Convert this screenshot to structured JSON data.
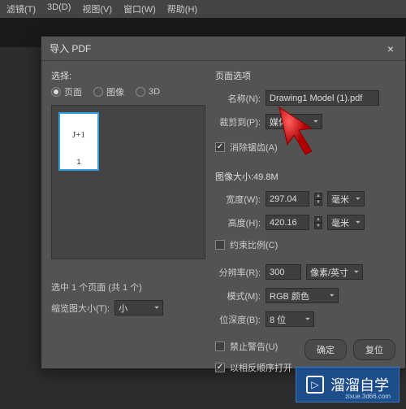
{
  "menubar": {
    "filter": "滤镜(T)",
    "threed": "3D(D)",
    "view": "视图(V)",
    "window": "窗口(W)",
    "help": "帮助(H)"
  },
  "dialog": {
    "title": "导入 PDF",
    "close": "×"
  },
  "left": {
    "select_label": "选择:",
    "radio_page": "页面",
    "radio_image": "图像",
    "radio_3d": "3D",
    "thumb_content": "J+1",
    "thumb_num": "1",
    "selection_text": "选中 1 个页面 (共 1 个)",
    "thumb_size_label": "缩览图大小(T):",
    "thumb_size_value": "小"
  },
  "right": {
    "page_options": "页面选项",
    "name_label": "名称(N):",
    "name_value": "Drawing1 Model (1).pdf",
    "crop_label": "裁剪到(P):",
    "crop_value": "媒体框",
    "antialias": "消除锯齿(A)",
    "size_label": "图像大小:49.8M",
    "width_label": "宽度(W):",
    "width_value": "297.04",
    "width_unit": "毫米",
    "height_label": "高度(H):",
    "height_value": "420.16",
    "height_unit": "毫米",
    "constrain": "约束比例(C)",
    "res_label": "分辨率(R):",
    "res_value": "300",
    "res_unit": "像素/英寸",
    "mode_label": "模式(M):",
    "mode_value": "RGB 颜色",
    "depth_label": "位深度(B):",
    "depth_value": "8 位",
    "suppress": "禁止警告(U)",
    "reverse": "以相反顺序打开"
  },
  "buttons": {
    "ok": "确定",
    "reset": "复位"
  },
  "watermark": {
    "text": "溜溜自学",
    "url": "zixue.3d66.com"
  }
}
